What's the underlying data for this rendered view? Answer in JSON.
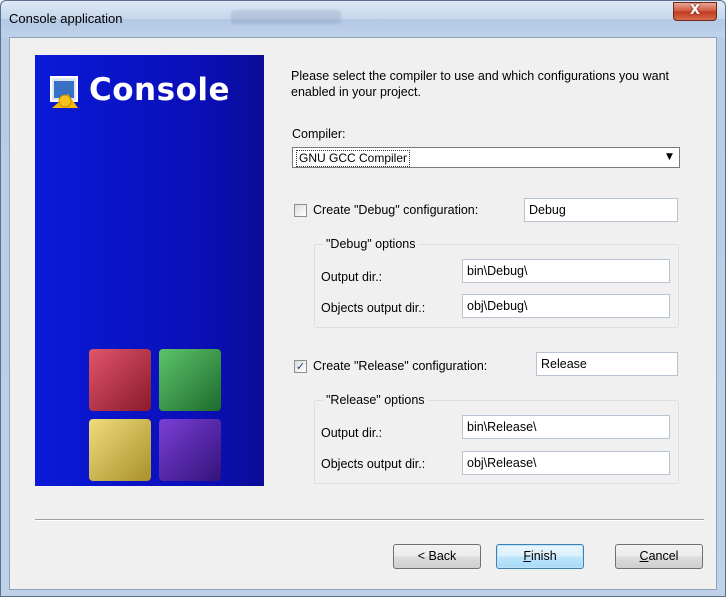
{
  "window": {
    "title": "Console application",
    "close_glyph": "X"
  },
  "banner": {
    "title": "Console",
    "icon": "app-icon"
  },
  "intro": "Please select the compiler to use and which configurations you want enabled in your project.",
  "compiler": {
    "label": "Compiler:",
    "selected": "GNU GCC Compiler"
  },
  "debug": {
    "checkbox_label": "Create \"Debug\" configuration:",
    "checked": false,
    "name": "Debug",
    "group_title": "\"Debug\" options",
    "output_label": "Output dir.:",
    "output_value": "bin\\Debug\\",
    "objects_label": "Objects output dir.:",
    "objects_value": "obj\\Debug\\"
  },
  "release": {
    "checkbox_label": "Create \"Release\" configuration:",
    "checked": true,
    "check_glyph": "✓",
    "name": "Release",
    "group_title": "\"Release\" options",
    "output_label": "Output dir.:",
    "output_value": "bin\\Release\\",
    "objects_label": "Objects output dir.:",
    "objects_value": "obj\\Release\\"
  },
  "buttons": {
    "back_prefix": "< ",
    "back_label": "Back",
    "finish_first": "F",
    "finish_rest": "inish",
    "cancel_first": "C",
    "cancel_rest": "ancel"
  },
  "colors": {
    "banner": "#0b14c8",
    "default_button": "#bee6fd"
  }
}
